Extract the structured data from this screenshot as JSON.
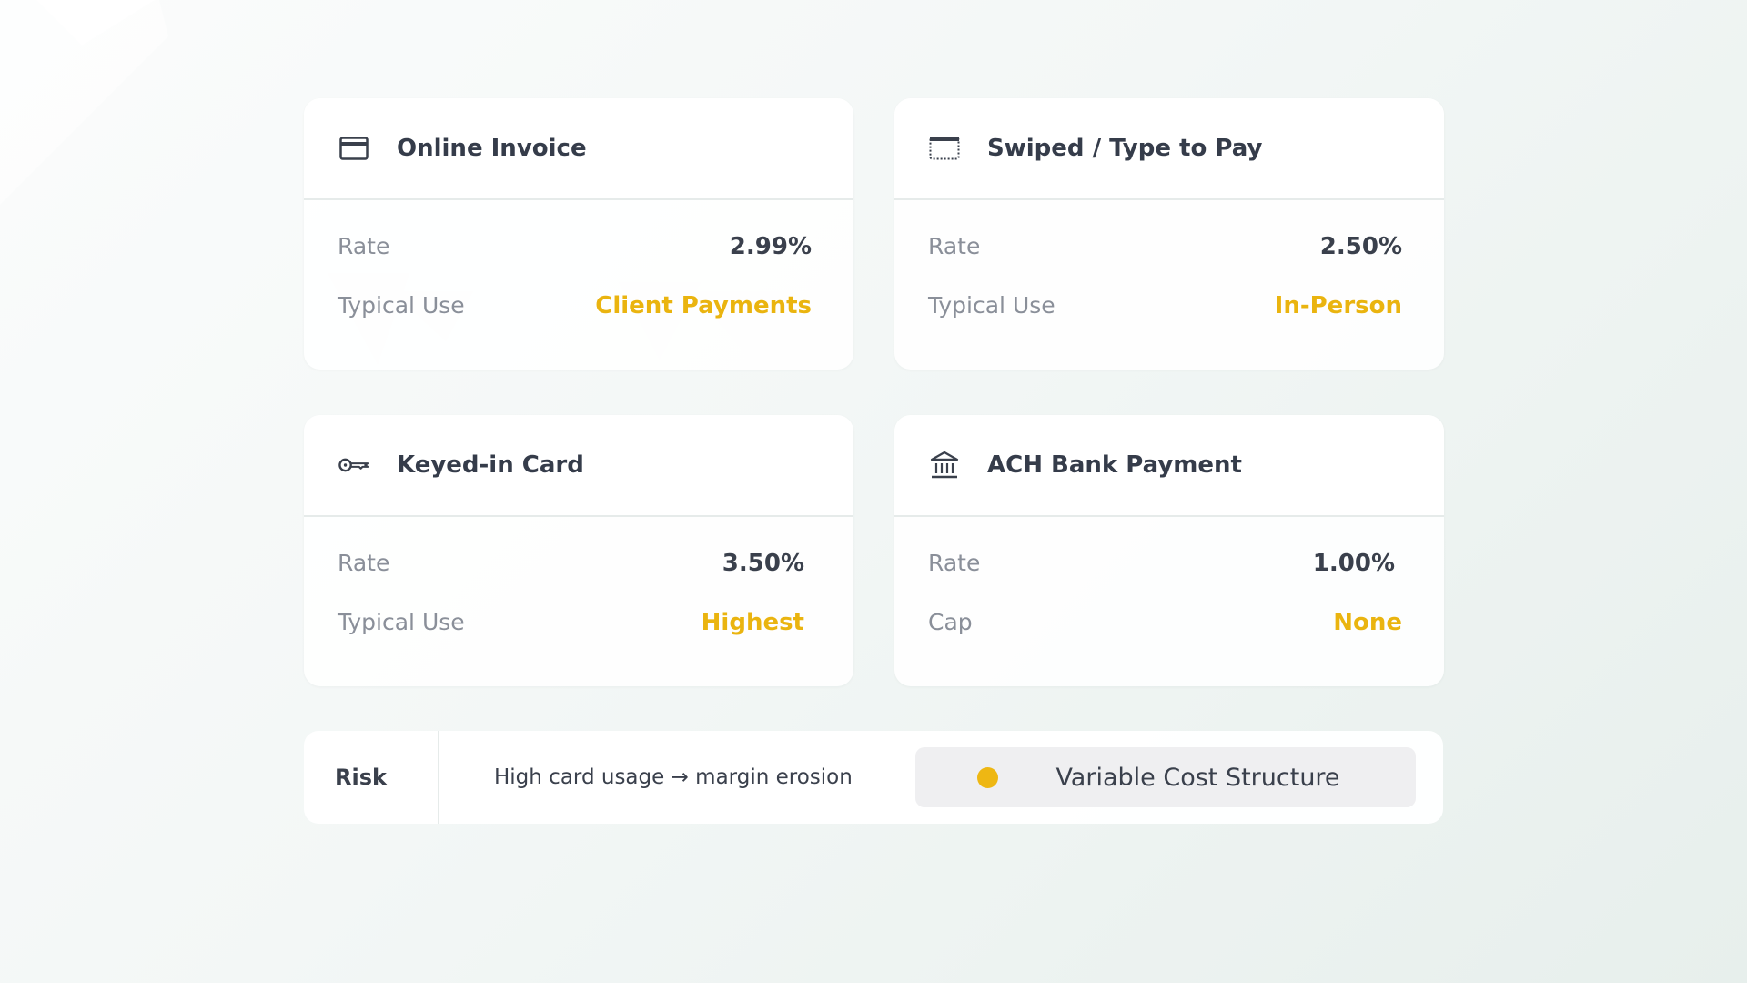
{
  "colors": {
    "accent": "#eab40f",
    "text_primary": "#353c4a",
    "text_muted": "#8a8f99",
    "pill_bg": "#efeff1"
  },
  "cards": [
    {
      "icon": "credit-card-icon",
      "title": "Online Invoice",
      "rows": [
        {
          "label": "Rate",
          "value": "2.99%"
        },
        {
          "label": "Typical Use",
          "value": "Client Payments"
        }
      ]
    },
    {
      "icon": "card-reader-icon",
      "title": "Swiped / Type to Pay",
      "rows": [
        {
          "label": "Rate",
          "value": "2.50%"
        },
        {
          "label": "Typical Use",
          "value": "In-Person"
        }
      ]
    },
    {
      "icon": "key-icon",
      "title": "Keyed-in Card",
      "rows": [
        {
          "label": "Rate",
          "value": "3.50%"
        },
        {
          "label": "Typical Use",
          "value": "Highest"
        }
      ]
    },
    {
      "icon": "bank-icon",
      "title": "ACH Bank Payment",
      "rows": [
        {
          "label": "Rate",
          "value": "1.00%"
        },
        {
          "label": "Cap",
          "value": "None"
        }
      ]
    }
  ],
  "risk": {
    "label": "Risk",
    "text": "High card usage → margin erosion",
    "pill_label": "Variable Cost Structure"
  }
}
